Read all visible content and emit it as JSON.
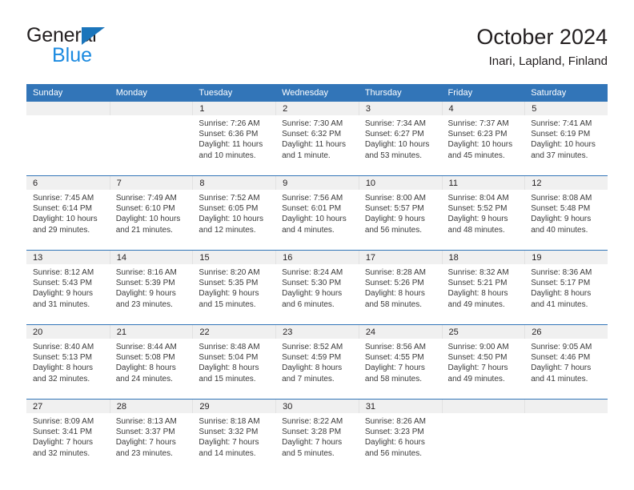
{
  "brand": {
    "line1": "General",
    "line2": "Blue",
    "triangle_color": "#1b75bb",
    "blue_text_color": "#1b8ae0"
  },
  "header": {
    "title": "October 2024",
    "subtitle": "Inari, Lapland, Finland"
  },
  "theme": {
    "header_blue": "#3275b8",
    "daynum_band": "#f0f0f0",
    "body_text": "#3a3a3a"
  },
  "weekdays": [
    "Sunday",
    "Monday",
    "Tuesday",
    "Wednesday",
    "Thursday",
    "Friday",
    "Saturday"
  ],
  "weeks": [
    [
      {
        "day": ""
      },
      {
        "day": ""
      },
      {
        "day": "1",
        "sunrise": "Sunrise: 7:26 AM",
        "sunset": "Sunset: 6:36 PM",
        "daylight1": "Daylight: 11 hours",
        "daylight2": "and 10 minutes."
      },
      {
        "day": "2",
        "sunrise": "Sunrise: 7:30 AM",
        "sunset": "Sunset: 6:32 PM",
        "daylight1": "Daylight: 11 hours",
        "daylight2": "and 1 minute."
      },
      {
        "day": "3",
        "sunrise": "Sunrise: 7:34 AM",
        "sunset": "Sunset: 6:27 PM",
        "daylight1": "Daylight: 10 hours",
        "daylight2": "and 53 minutes."
      },
      {
        "day": "4",
        "sunrise": "Sunrise: 7:37 AM",
        "sunset": "Sunset: 6:23 PM",
        "daylight1": "Daylight: 10 hours",
        "daylight2": "and 45 minutes."
      },
      {
        "day": "5",
        "sunrise": "Sunrise: 7:41 AM",
        "sunset": "Sunset: 6:19 PM",
        "daylight1": "Daylight: 10 hours",
        "daylight2": "and 37 minutes."
      }
    ],
    [
      {
        "day": "6",
        "sunrise": "Sunrise: 7:45 AM",
        "sunset": "Sunset: 6:14 PM",
        "daylight1": "Daylight: 10 hours",
        "daylight2": "and 29 minutes."
      },
      {
        "day": "7",
        "sunrise": "Sunrise: 7:49 AM",
        "sunset": "Sunset: 6:10 PM",
        "daylight1": "Daylight: 10 hours",
        "daylight2": "and 21 minutes."
      },
      {
        "day": "8",
        "sunrise": "Sunrise: 7:52 AM",
        "sunset": "Sunset: 6:05 PM",
        "daylight1": "Daylight: 10 hours",
        "daylight2": "and 12 minutes."
      },
      {
        "day": "9",
        "sunrise": "Sunrise: 7:56 AM",
        "sunset": "Sunset: 6:01 PM",
        "daylight1": "Daylight: 10 hours",
        "daylight2": "and 4 minutes."
      },
      {
        "day": "10",
        "sunrise": "Sunrise: 8:00 AM",
        "sunset": "Sunset: 5:57 PM",
        "daylight1": "Daylight: 9 hours",
        "daylight2": "and 56 minutes."
      },
      {
        "day": "11",
        "sunrise": "Sunrise: 8:04 AM",
        "sunset": "Sunset: 5:52 PM",
        "daylight1": "Daylight: 9 hours",
        "daylight2": "and 48 minutes."
      },
      {
        "day": "12",
        "sunrise": "Sunrise: 8:08 AM",
        "sunset": "Sunset: 5:48 PM",
        "daylight1": "Daylight: 9 hours",
        "daylight2": "and 40 minutes."
      }
    ],
    [
      {
        "day": "13",
        "sunrise": "Sunrise: 8:12 AM",
        "sunset": "Sunset: 5:43 PM",
        "daylight1": "Daylight: 9 hours",
        "daylight2": "and 31 minutes."
      },
      {
        "day": "14",
        "sunrise": "Sunrise: 8:16 AM",
        "sunset": "Sunset: 5:39 PM",
        "daylight1": "Daylight: 9 hours",
        "daylight2": "and 23 minutes."
      },
      {
        "day": "15",
        "sunrise": "Sunrise: 8:20 AM",
        "sunset": "Sunset: 5:35 PM",
        "daylight1": "Daylight: 9 hours",
        "daylight2": "and 15 minutes."
      },
      {
        "day": "16",
        "sunrise": "Sunrise: 8:24 AM",
        "sunset": "Sunset: 5:30 PM",
        "daylight1": "Daylight: 9 hours",
        "daylight2": "and 6 minutes."
      },
      {
        "day": "17",
        "sunrise": "Sunrise: 8:28 AM",
        "sunset": "Sunset: 5:26 PM",
        "daylight1": "Daylight: 8 hours",
        "daylight2": "and 58 minutes."
      },
      {
        "day": "18",
        "sunrise": "Sunrise: 8:32 AM",
        "sunset": "Sunset: 5:21 PM",
        "daylight1": "Daylight: 8 hours",
        "daylight2": "and 49 minutes."
      },
      {
        "day": "19",
        "sunrise": "Sunrise: 8:36 AM",
        "sunset": "Sunset: 5:17 PM",
        "daylight1": "Daylight: 8 hours",
        "daylight2": "and 41 minutes."
      }
    ],
    [
      {
        "day": "20",
        "sunrise": "Sunrise: 8:40 AM",
        "sunset": "Sunset: 5:13 PM",
        "daylight1": "Daylight: 8 hours",
        "daylight2": "and 32 minutes."
      },
      {
        "day": "21",
        "sunrise": "Sunrise: 8:44 AM",
        "sunset": "Sunset: 5:08 PM",
        "daylight1": "Daylight: 8 hours",
        "daylight2": "and 24 minutes."
      },
      {
        "day": "22",
        "sunrise": "Sunrise: 8:48 AM",
        "sunset": "Sunset: 5:04 PM",
        "daylight1": "Daylight: 8 hours",
        "daylight2": "and 15 minutes."
      },
      {
        "day": "23",
        "sunrise": "Sunrise: 8:52 AM",
        "sunset": "Sunset: 4:59 PM",
        "daylight1": "Daylight: 8 hours",
        "daylight2": "and 7 minutes."
      },
      {
        "day": "24",
        "sunrise": "Sunrise: 8:56 AM",
        "sunset": "Sunset: 4:55 PM",
        "daylight1": "Daylight: 7 hours",
        "daylight2": "and 58 minutes."
      },
      {
        "day": "25",
        "sunrise": "Sunrise: 9:00 AM",
        "sunset": "Sunset: 4:50 PM",
        "daylight1": "Daylight: 7 hours",
        "daylight2": "and 49 minutes."
      },
      {
        "day": "26",
        "sunrise": "Sunrise: 9:05 AM",
        "sunset": "Sunset: 4:46 PM",
        "daylight1": "Daylight: 7 hours",
        "daylight2": "and 41 minutes."
      }
    ],
    [
      {
        "day": "27",
        "sunrise": "Sunrise: 8:09 AM",
        "sunset": "Sunset: 3:41 PM",
        "daylight1": "Daylight: 7 hours",
        "daylight2": "and 32 minutes."
      },
      {
        "day": "28",
        "sunrise": "Sunrise: 8:13 AM",
        "sunset": "Sunset: 3:37 PM",
        "daylight1": "Daylight: 7 hours",
        "daylight2": "and 23 minutes."
      },
      {
        "day": "29",
        "sunrise": "Sunrise: 8:18 AM",
        "sunset": "Sunset: 3:32 PM",
        "daylight1": "Daylight: 7 hours",
        "daylight2": "and 14 minutes."
      },
      {
        "day": "30",
        "sunrise": "Sunrise: 8:22 AM",
        "sunset": "Sunset: 3:28 PM",
        "daylight1": "Daylight: 7 hours",
        "daylight2": "and 5 minutes."
      },
      {
        "day": "31",
        "sunrise": "Sunrise: 8:26 AM",
        "sunset": "Sunset: 3:23 PM",
        "daylight1": "Daylight: 6 hours",
        "daylight2": "and 56 minutes."
      },
      {
        "day": ""
      },
      {
        "day": ""
      }
    ]
  ]
}
